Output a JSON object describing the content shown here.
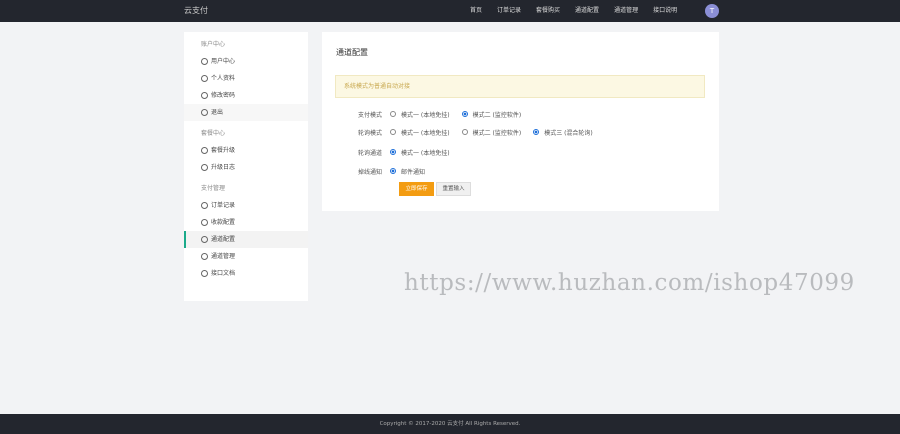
{
  "header": {
    "logo": "云支付",
    "nav": [
      "首页",
      "订单记录",
      "套餐购买",
      "通道配置",
      "通道管理",
      "接口说明"
    ],
    "avatar_letter": "T"
  },
  "sidebar": {
    "groups": [
      {
        "title": "账户中心",
        "items": [
          {
            "label": "用户中心",
            "icon": "user-circle-icon"
          },
          {
            "label": "个人资料",
            "icon": "person-icon"
          },
          {
            "label": "修改密码",
            "icon": "key-icon"
          },
          {
            "label": "退出",
            "icon": "eye-icon"
          }
        ]
      },
      {
        "title": "套餐中心",
        "items": [
          {
            "label": "套餐升级",
            "icon": "arrow-up-icon"
          },
          {
            "label": "升级日志",
            "icon": "list-icon"
          }
        ]
      },
      {
        "title": "支付管理",
        "items": [
          {
            "label": "订单记录",
            "icon": "order-icon"
          },
          {
            "label": "收款配置",
            "icon": "gear-icon"
          },
          {
            "label": "通道配置",
            "icon": "channel-icon"
          },
          {
            "label": "通道管理",
            "icon": "manage-icon"
          },
          {
            "label": "接口文档",
            "icon": "doc-icon"
          }
        ]
      }
    ]
  },
  "panel": {
    "title": "通道配置",
    "notice": "系统模式为普通自动对接",
    "rows": [
      {
        "label": "支付模式",
        "options": [
          "模式一 (本地免挂)",
          "模式二 (监控软件)"
        ],
        "selected": 1
      },
      {
        "label": "轮询模式",
        "options": [
          "模式一 (本地免挂)",
          "模式二 (监控软件)",
          "模式三 (混合轮询)"
        ],
        "selected": 2
      },
      {
        "label": "轮询通道",
        "options": [
          "模式一 (本地免挂)"
        ],
        "selected": 0
      },
      {
        "label": "掉线通知",
        "options": [
          "邮件通知"
        ],
        "selected": 0
      }
    ],
    "save_label": "立即保存",
    "reset_label": "重置输入"
  },
  "watermark": "https://www.huzhan.com/ishop47099",
  "footer": "Copyright © 2017-2020 云支付 All Rights Reserved."
}
